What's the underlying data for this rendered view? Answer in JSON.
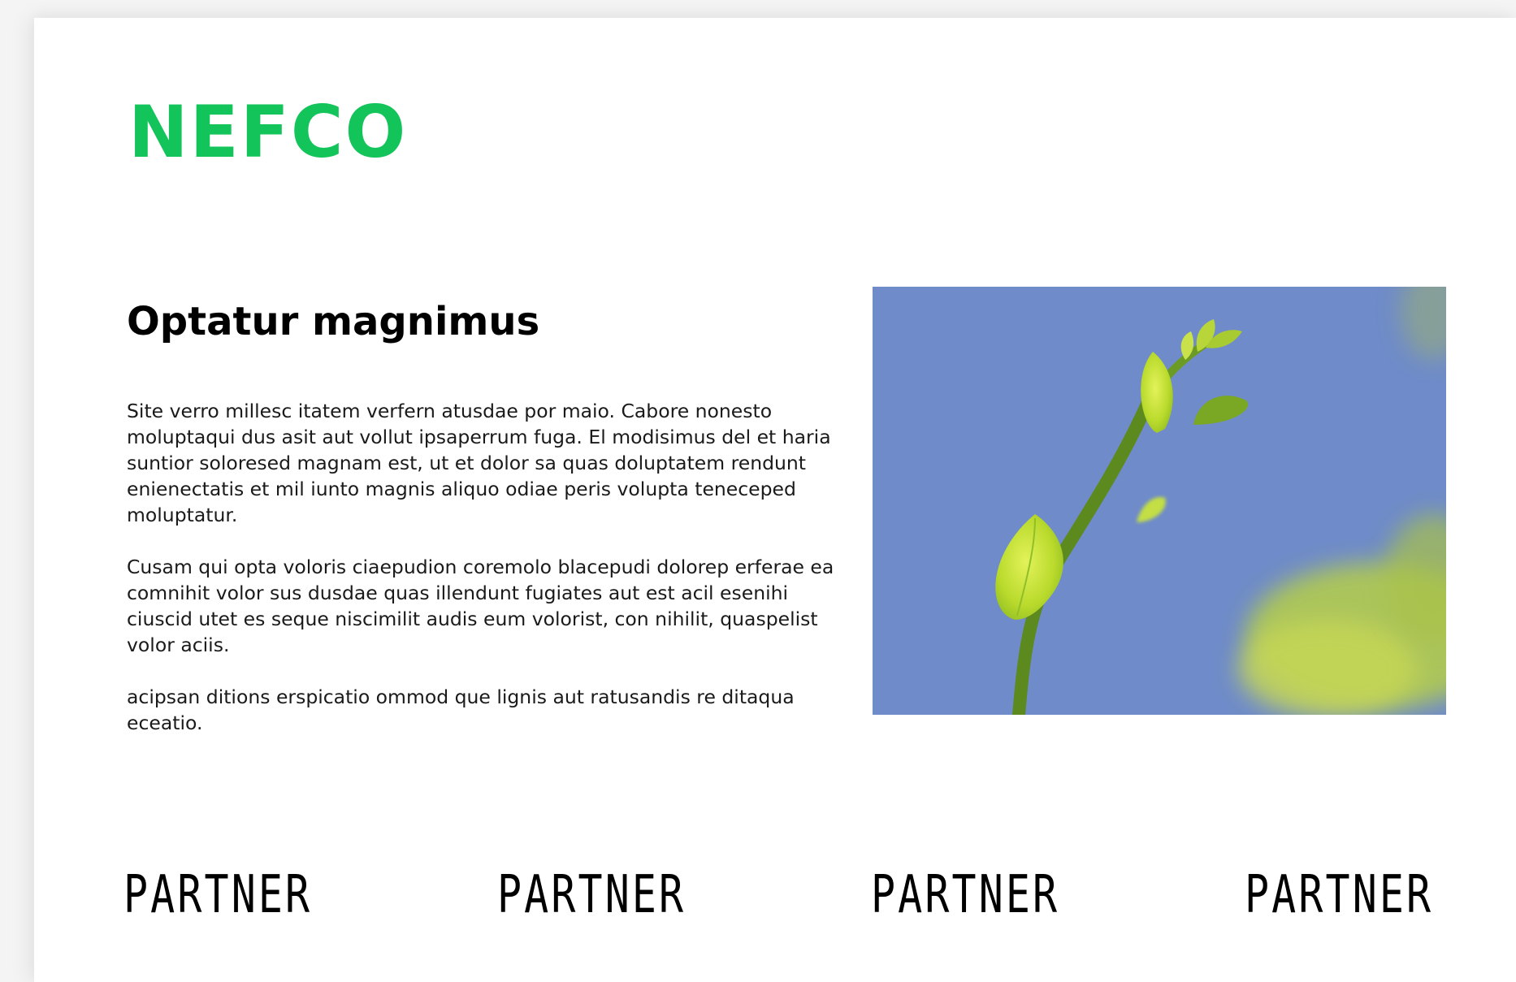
{
  "logo": {
    "text": "NEFCO",
    "color": "#12c45a"
  },
  "section": {
    "heading": "Optatur magnimus",
    "paragraphs": [
      "Site verro millesc itatem verfern atusdae por maio. Cabore nonesto moluptaqui dus asit aut vollut ipsaperrum fuga. El modisimus del et haria suntior soloresed magnam est, ut et dolor sa quas doluptatem rendunt enienectatis et mil iunto magnis aliquo odiae peris volupta teneceped moluptatur.",
      "Cusam qui opta voloris ciaepudion coremolo blacepudi dolorep erferae ea comnihit volor sus dusdae quas illendunt fugiates aut est acil esenihi ciuscid utet es seque niscimilit audis eum volorist, con nihilit, quaspelist volor aciis.",
      "acipsan ditions erspicatio ommod que lignis aut ratusandis re ditaqua eceatio."
    ]
  },
  "image": {
    "subject": "green plant sprout against blue sky",
    "sky_color": "#6f8bc9",
    "leaf_color": "#c6e23a"
  },
  "partners": [
    {
      "label": "PARTNER"
    },
    {
      "label": "PARTNER"
    },
    {
      "label": "PARTNER"
    },
    {
      "label": "PARTNER"
    }
  ]
}
